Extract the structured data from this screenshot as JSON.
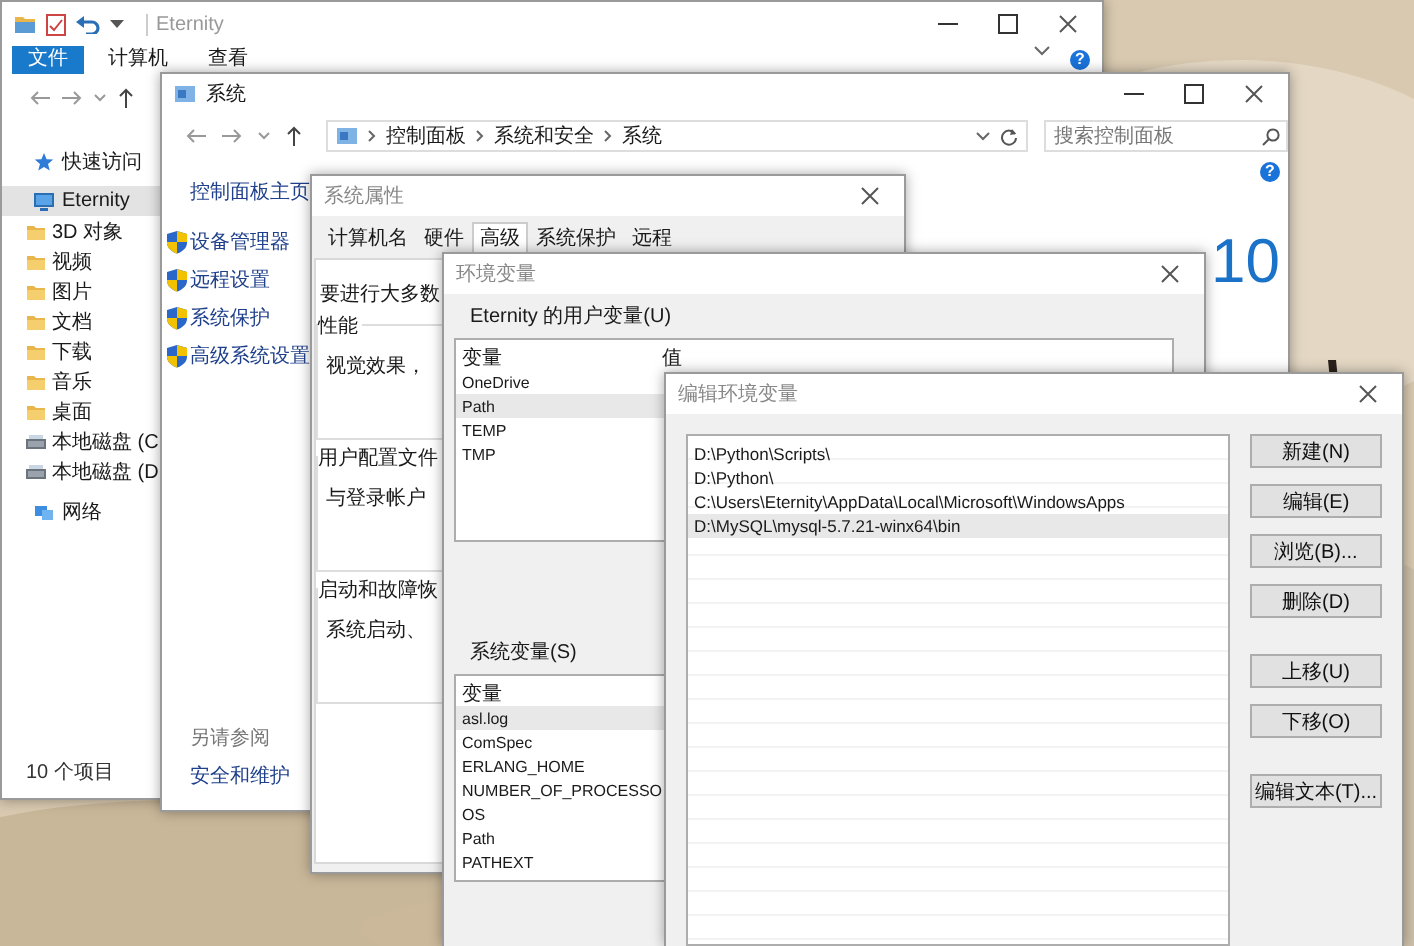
{
  "explorer": {
    "title": "Eternity",
    "help": "?",
    "ribbon_tabs": [
      {
        "label": "文件",
        "selected": true
      },
      {
        "label": "计算机",
        "selected": false
      },
      {
        "label": "查看",
        "selected": false
      }
    ],
    "navigation": [
      {
        "label": "快速访问",
        "kind": "quick",
        "selected": false
      },
      {
        "label": "Eternity",
        "kind": "pc",
        "selected": true,
        "children": [
          {
            "label": "3D 对象",
            "kind": "folder",
            "selected": false
          },
          {
            "label": "视频",
            "kind": "folder",
            "selected": false
          },
          {
            "label": "图片",
            "kind": "folder",
            "selected": false
          },
          {
            "label": "文档",
            "kind": "folder",
            "selected": false
          },
          {
            "label": "下载",
            "kind": "folder",
            "selected": false
          },
          {
            "label": "音乐",
            "kind": "folder",
            "selected": false
          },
          {
            "label": "桌面",
            "kind": "folder",
            "selected": false
          },
          {
            "label": "本地磁盘 (C",
            "kind": "drive",
            "selected": false
          },
          {
            "label": "本地磁盘 (D",
            "kind": "drive",
            "selected": false
          }
        ]
      },
      {
        "label": "网络",
        "kind": "network",
        "selected": false
      }
    ],
    "status_bar": "10 个项目"
  },
  "control_panel": {
    "title": "系统",
    "help": "?",
    "breadcrumb": [
      "控制面板",
      "系统和安全",
      "系统"
    ],
    "search": {
      "placeholder": "搜索控制面板"
    },
    "home_link": "控制面板主页",
    "tasks": [
      "设备管理器",
      "远程设置",
      "系统保护",
      "高级系统设置"
    ],
    "see_also_heading": "另请参阅",
    "see_also_links": [
      "安全和维护"
    ],
    "edition_text": "10"
  },
  "system_properties": {
    "title": "系统属性",
    "tabs": [
      {
        "label": "计算机名",
        "selected": false
      },
      {
        "label": "硬件",
        "selected": false
      },
      {
        "label": "高级",
        "selected": true
      },
      {
        "label": "系统保护",
        "selected": false
      },
      {
        "label": "远程",
        "selected": false
      }
    ],
    "intro": "要进行大多数",
    "sections": [
      {
        "title": "性能",
        "text": "视觉效果，"
      },
      {
        "title": "用户配置文件",
        "text": "与登录帐户"
      },
      {
        "title": "启动和故障恢",
        "text": "系统启动、"
      }
    ]
  },
  "environment_variables": {
    "title": "环境变量",
    "user_label": "Eternity 的用户变量(U)",
    "user_table": {
      "columns": [
        "变量",
        "值"
      ],
      "rows": [
        {
          "name": "OneDrive",
          "selected": false
        },
        {
          "name": "Path",
          "selected": true
        },
        {
          "name": "TEMP",
          "selected": false
        },
        {
          "name": "TMP",
          "selected": false
        }
      ]
    },
    "system_label": "系统变量(S)",
    "system_table": {
      "columns": [
        "变量"
      ],
      "rows": [
        {
          "name": "asl.log",
          "selected": true
        },
        {
          "name": "ComSpec",
          "selected": false
        },
        {
          "name": "ERLANG_HOME",
          "selected": false
        },
        {
          "name": "NUMBER_OF_PROCESSO",
          "selected": false
        },
        {
          "name": "OS",
          "selected": false
        },
        {
          "name": "Path",
          "selected": false
        },
        {
          "name": "PATHEXT",
          "selected": false
        }
      ]
    }
  },
  "edit_variable": {
    "title": "编辑环境变量",
    "entries": [
      {
        "text": "D:\\Python\\Scripts\\",
        "selected": false
      },
      {
        "text": "D:\\Python\\",
        "selected": false
      },
      {
        "text": "C:\\Users\\Eternity\\AppData\\Local\\Microsoft\\WindowsApps",
        "selected": false
      },
      {
        "text": "D:\\MySQL\\mysql-5.7.21-winx64\\bin",
        "selected": true
      }
    ],
    "button_groups": [
      [
        "新建(N)",
        "编辑(E)",
        "浏览(B)...",
        "删除(D)"
      ],
      [
        "上移(U)",
        "下移(O)"
      ],
      [
        "编辑文本(T)..."
      ]
    ]
  }
}
